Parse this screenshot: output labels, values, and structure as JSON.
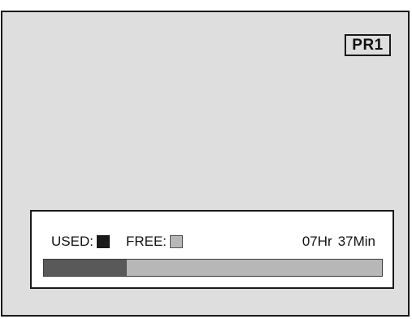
{
  "channel": {
    "label": "PR1"
  },
  "legend": {
    "used_label": "USED:",
    "free_label": "FREE:"
  },
  "remaining_time": {
    "hours": "07Hr",
    "minutes": "37Min"
  },
  "usage": {
    "used_fraction": 0.245
  },
  "colors": {
    "screen_background": "#dedede",
    "used": "#595959",
    "free": "#b7b7b7",
    "border": "#1a1a1a"
  }
}
